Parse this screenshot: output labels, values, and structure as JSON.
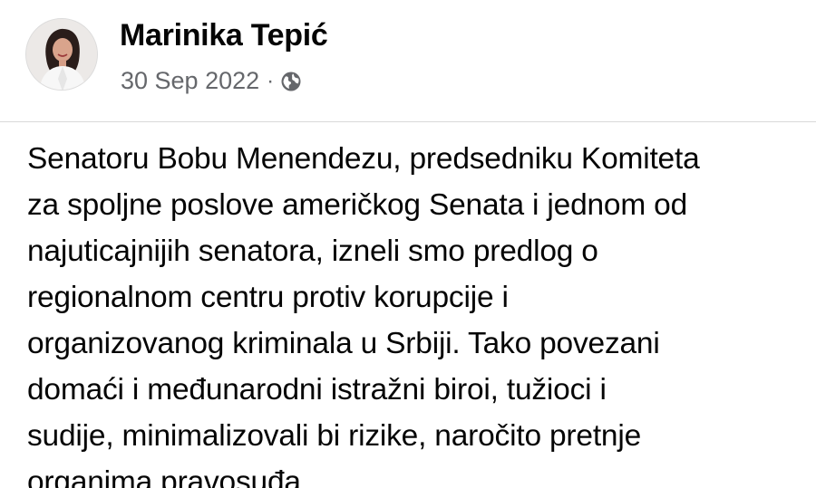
{
  "post": {
    "author_name": "Marinika Tepić",
    "date": "30 Sep 2022",
    "separator": "·",
    "privacy_icon": "globe-icon",
    "text_lines": [
      "Senatoru Bobu Menendezu, predsedniku Komiteta",
      "za spoljne poslove američkog Senata i jednom od",
      "najuticajnijih senatora, izneli smo predlog o",
      "regionalnom centru protiv korupcije i",
      "organizovanog kriminala u Srbiji. Tako povezani",
      "domaći i međunarodni istražni biroi, tužioci i",
      "sudije, minimalizovali bi rizike, naročito pretnje",
      "organima pravosuđa."
    ]
  },
  "colors": {
    "text": "#050505",
    "secondary_text": "#65676b",
    "divider": "#d9d9d9",
    "background": "#ffffff"
  }
}
